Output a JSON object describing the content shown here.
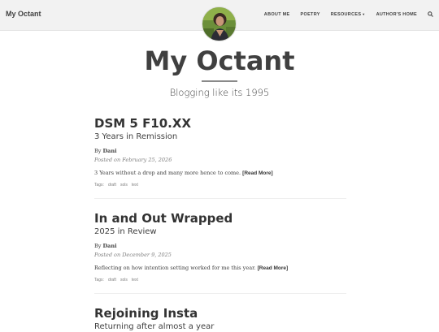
{
  "navbar": {
    "brand": "My Octant",
    "links": [
      "About Me",
      "Poetry",
      "Resources",
      "Author's Home"
    ]
  },
  "header": {
    "title": "My Octant",
    "subtitle": "Blogging like its 1995"
  },
  "posts": [
    {
      "title": "DSM 5 F10.XX",
      "subtitle": "3 Years in Remission",
      "by_prefix": "By",
      "author": "Dani",
      "posted": "Posted on February 25, 2026",
      "excerpt": "3 Years without a drop and many more hence to come.",
      "read_more": "[Read More]",
      "tags_label": "Tags:",
      "tags": [
        "draft",
        "sols",
        "text"
      ]
    },
    {
      "title": "In and Out Wrapped",
      "subtitle": "2025 in Review",
      "by_prefix": "By",
      "author": "Dani",
      "posted": "Posted on December 9, 2025",
      "excerpt": "Reflecting on how intention setting worked for me this year.",
      "read_more": "[Read More]",
      "tags_label": "Tags:",
      "tags": [
        "draft",
        "sols",
        "text"
      ]
    },
    {
      "title": "Rejoining Insta",
      "subtitle": "Returning after almost a year"
    }
  ],
  "colors": {
    "navbar_bg": "#f2f2f2",
    "text": "#404040",
    "meta": "#808080"
  },
  "icons": {
    "search": "search-icon",
    "caret": "caret-down-icon"
  }
}
